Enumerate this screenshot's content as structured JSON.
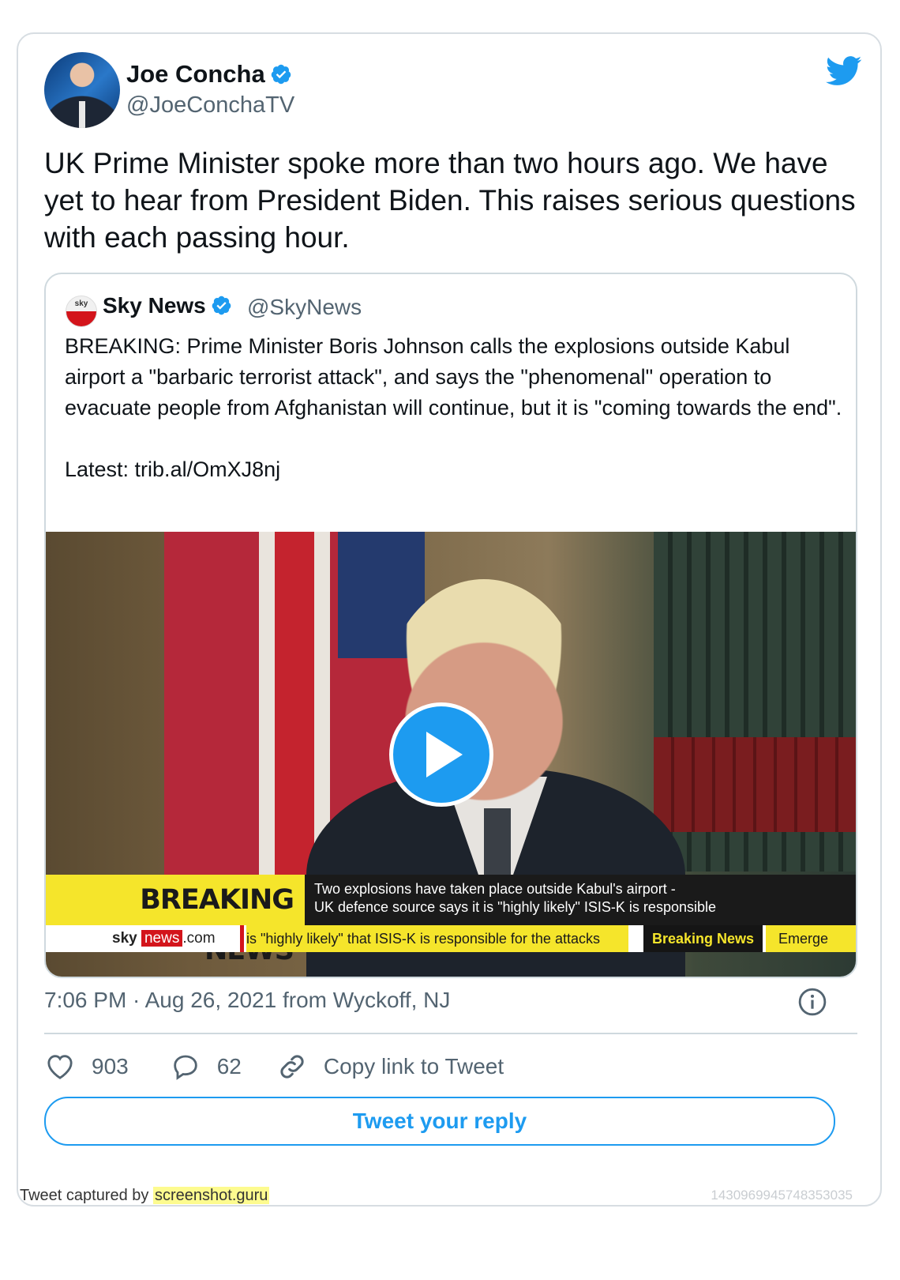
{
  "author": {
    "name": "Joe Concha",
    "handle": "@JoeConchaTV",
    "verified": true,
    "avatar_icon": "profile-photo"
  },
  "tweet": {
    "text": "UK Prime Minister spoke more than two hours ago. We have yet to hear from President Biden. This raises serious questions with each passing hour.",
    "timestamp": "7:06 PM · Aug 26, 2021 from Wyckoff, NJ"
  },
  "quoted_tweet": {
    "name": "Sky News",
    "handle": "@SkyNews",
    "verified": true,
    "avatar_label": "sky",
    "text": "BREAKING: Prime Minister Boris Johnson calls the explosions outside Kabul airport a \"barbaric terrorist attack\", and says the \"phenomenal\" operation to evacuate people from Afghanistan will continue, but it is \"coming towards the end\".\n\nLatest: trib.al/OmXJ8nj",
    "video": {
      "breaking_label": "BREAKING NEWS",
      "breaking_line1": "Two explosions have taken place outside Kabul's airport -",
      "breaking_line2": "UK defence source says it is \"highly likely\" ISIS-K is responsible",
      "logo_sky": "sky",
      "logo_news": "news",
      "logo_dotcom": ".com",
      "ticker_text": "is \"highly likely\" that ISIS-K is responsible for the attacks",
      "ticker_tag": "Breaking News",
      "ticker_next": "Emerge"
    }
  },
  "actions": {
    "likes": "903",
    "replies": "62",
    "copy_link": "Copy link to Tweet",
    "reply_button": "Tweet your reply"
  },
  "footer": {
    "captured_by": "Tweet captured by",
    "site": "screenshot.guru",
    "tweet_id": "1430969945748353035"
  },
  "colors": {
    "accent": "#1d9bf0",
    "text": "#0f1419",
    "muted": "#536471",
    "breaking_yellow": "#f5e52b",
    "sky_red": "#d3141b"
  }
}
